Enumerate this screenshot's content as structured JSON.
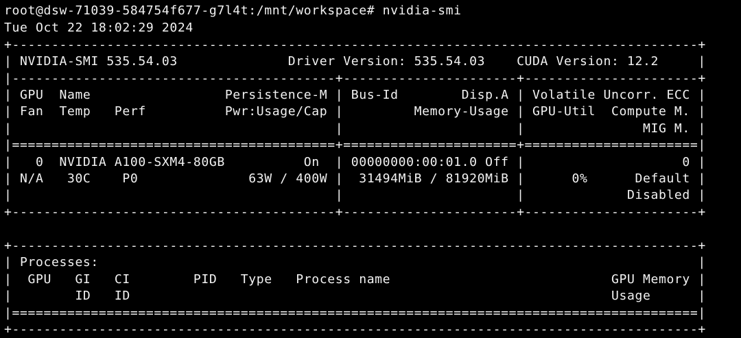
{
  "terminal": {
    "prompt_line": "root@dsw-71039-584754f677-g7l4t:/mnt/workspace# nvidia-smi",
    "timestamp": "Tue Oct 22 18:02:29 2024",
    "border_top": "+---------------------------------------------------------------------------------------+",
    "header_line": "| NVIDIA-SMI 535.54.03              Driver Version: 535.54.03    CUDA Version: 12.2     |",
    "header_sep": "|-----------------------------------------+----------------------+----------------------+",
    "col_header_1": "| GPU  Name                 Persistence-M | Bus-Id        Disp.A | Volatile Uncorr. ECC |",
    "col_header_2": "| Fan  Temp   Perf          Pwr:Usage/Cap |         Memory-Usage | GPU-Util  Compute M. |",
    "col_header_3": "|                                         |                      |               MIG M. |",
    "double_sep": "|=========================================+======================+======================|",
    "gpu_row_1": "|   0  NVIDIA A100-SXM4-80GB          On  | 00000000:00:01.0 Off |                    0 |",
    "gpu_row_2": "| N/A   30C    P0              63W / 400W |  31494MiB / 81920MiB |      0%      Default |",
    "gpu_row_3": "|                                         |                      |             Disabled |",
    "gpu_bottom": "+-----------------------------------------+----------------------+----------------------+",
    "blank": "",
    "proc_top": "+---------------------------------------------------------------------------------------+",
    "proc_title": "| Processes:                                                                            |",
    "proc_header_1": "|  GPU   GI   CI        PID   Type   Process name                            GPU Memory |",
    "proc_header_2": "|        ID   ID                                                             Usage      |",
    "proc_double_sep": "|=======================================================================================|",
    "proc_bottom": "+---------------------------------------------------------------------------------------+"
  }
}
